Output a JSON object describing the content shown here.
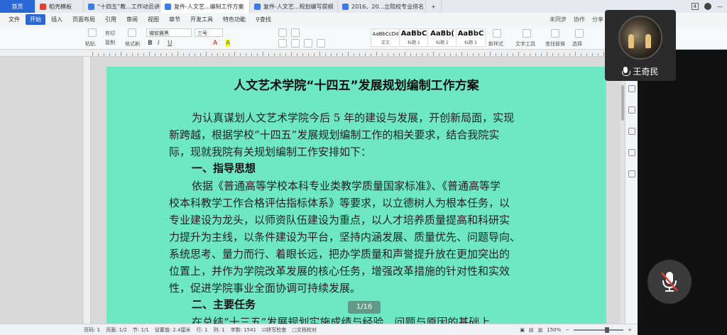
{
  "tabs": [
    {
      "label": "首页",
      "icon": "home-icon",
      "color": "#2a68d6"
    },
    {
      "label": "稻壳模板",
      "icon": "template-icon",
      "color": "#e0412f"
    },
    {
      "label": "“十四五”教...工作动员讲话",
      "icon": "word-doc-icon",
      "color": "#3d7be8"
    },
    {
      "label": "复件-人文艺...编制工作方案",
      "icon": "word-doc-icon",
      "color": "#3d7be8"
    },
    {
      "label": "复件-人文艺...规划编写提纲",
      "icon": "word-doc-icon",
      "color": "#3d7be8"
    },
    {
      "label": "2016、20...立院校专业排名",
      "icon": "word-doc-icon",
      "color": "#3d7be8"
    }
  ],
  "tab_count": "4",
  "menu": {
    "file": "文件",
    "items": [
      "开始",
      "插入",
      "页面布局",
      "引用",
      "审阅",
      "视图",
      "章节",
      "开发工具",
      "特色功能"
    ],
    "search": "查找",
    "sync": "未同步",
    "collab": "协作",
    "share": "分享"
  },
  "toolbar": {
    "cut": "剪切",
    "paste": "粘贴",
    "copy": "复制",
    "format_painter": "格式刷",
    "font_name": "微软雅黑",
    "font_size": "三号",
    "styles": [
      {
        "sample": "AaBbCcDd",
        "label": "正文"
      },
      {
        "sample": "AaBbC",
        "label": "标题 1"
      },
      {
        "sample": "AaBb(",
        "label": "标题 2"
      },
      {
        "sample": "AaBbC",
        "label": "标题 3"
      }
    ],
    "new_style": "新样式",
    "text_tools": "文字工具",
    "find_replace": "查找替换",
    "select": "选择"
  },
  "document": {
    "title": "人文艺术学院“十四五”发展规划编制工作方案",
    "intro_lines": [
      "为认真谋划人文艺术学院今后 5 年的建设与发展，开创新局面，实现",
      "新跨越，根据学校“十四五”发展规划编制工作的相关要求，结合我院实",
      "际，现就我院有关规划编制工作安排如下："
    ],
    "heading1": "一、指导思想",
    "para1_lines": [
      "依据《普通高等学校本科专业类教学质量国家标准》、《普通高等学",
      "校本科教学工作合格评估指标体系》等要求，以立德树人为根本任务，以",
      "专业建设为龙头，以师资队伍建设为重点，以人才培养质量提高和科研实",
      "力提升为主线，以条件建设为平台，坚持内涵发展、质量优先、问题导向、",
      "系统思考、量力而行、着眼长远，把办学质量和声誉提升放在更加突出的",
      "位置上，并作为学院改革发展的核心任务，增强改革措施的针对性和实效",
      "性，促进学院事业全面协调可持续发展。"
    ],
    "heading2": "二、主要任务",
    "para2_line": "在总结“十三五”发展规划实施成绩与经验、问题与原因的基础上，",
    "page_indicator": "1/16"
  },
  "status": {
    "page_num": "页码: 1",
    "page_of": "页面: 1/2",
    "section": "节: 1/1",
    "setting": "设置值: 2.4厘米",
    "row": "行: 1",
    "col": "列: 1",
    "word_count": "字数: 1541",
    "spell_check": "拼写检查",
    "doc_check": "文档校对",
    "zoom": "150%",
    "zoom_level": 0.63
  },
  "meeting": {
    "participant_name": "王奇民",
    "mic_muted": true
  }
}
